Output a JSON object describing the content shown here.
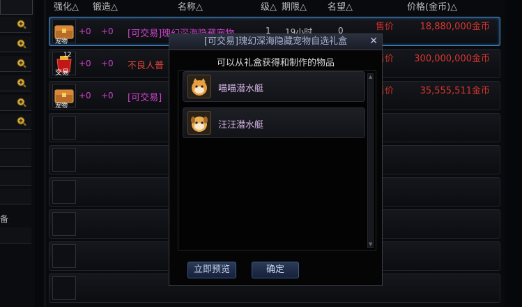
{
  "sidebar": {
    "label_fragment": "备",
    "zoom_icon": "magnifier-plus-icon"
  },
  "table": {
    "headers": [
      "强化△",
      "锻造△",
      "名称△",
      "级△",
      "期限△",
      "名望△",
      "价格(金币)△"
    ],
    "rows": [
      {
        "icon": "treasure-chest-icon",
        "icon_caption": "宠物",
        "enhance": "+0",
        "forge": "+0",
        "name": "[可交易]瑰幻深海隐藏宠物",
        "level": "1",
        "limit": "19小时",
        "fame": "0",
        "sell": "售价",
        "price": "18,880,000金币",
        "selected": true
      },
      {
        "icon": "red-bag-icon",
        "icon_badge": "12",
        "icon_caption": "交易",
        "enhance": "+0",
        "forge": "+0",
        "name": "不良人普",
        "sell": "售价",
        "price": "300,000,000金币",
        "selected": false
      },
      {
        "icon": "treasure-chest-icon",
        "icon_caption": "宠物",
        "enhance": "+0",
        "forge": "+0",
        "name": "[可交易]",
        "sell": "售价",
        "price": "35,555,511金币",
        "selected": false
      }
    ]
  },
  "dialog": {
    "title": "[可交易]瑰幻深海隐藏宠物自选礼盒",
    "close": "✕",
    "subtitle": "可以从礼盒获得和制作的物品",
    "options": [
      {
        "label": "喵喵潜水艇",
        "icon": "cat-submarine-icon"
      },
      {
        "label": "汪汪潜水艇",
        "icon": "dog-submarine-icon"
      }
    ],
    "preview_button": "立即预览",
    "confirm_button": "确定"
  },
  "colors": {
    "accent": "#4a8fd0",
    "price_red": "#d8362f",
    "item_purple": "#cc44cc"
  }
}
